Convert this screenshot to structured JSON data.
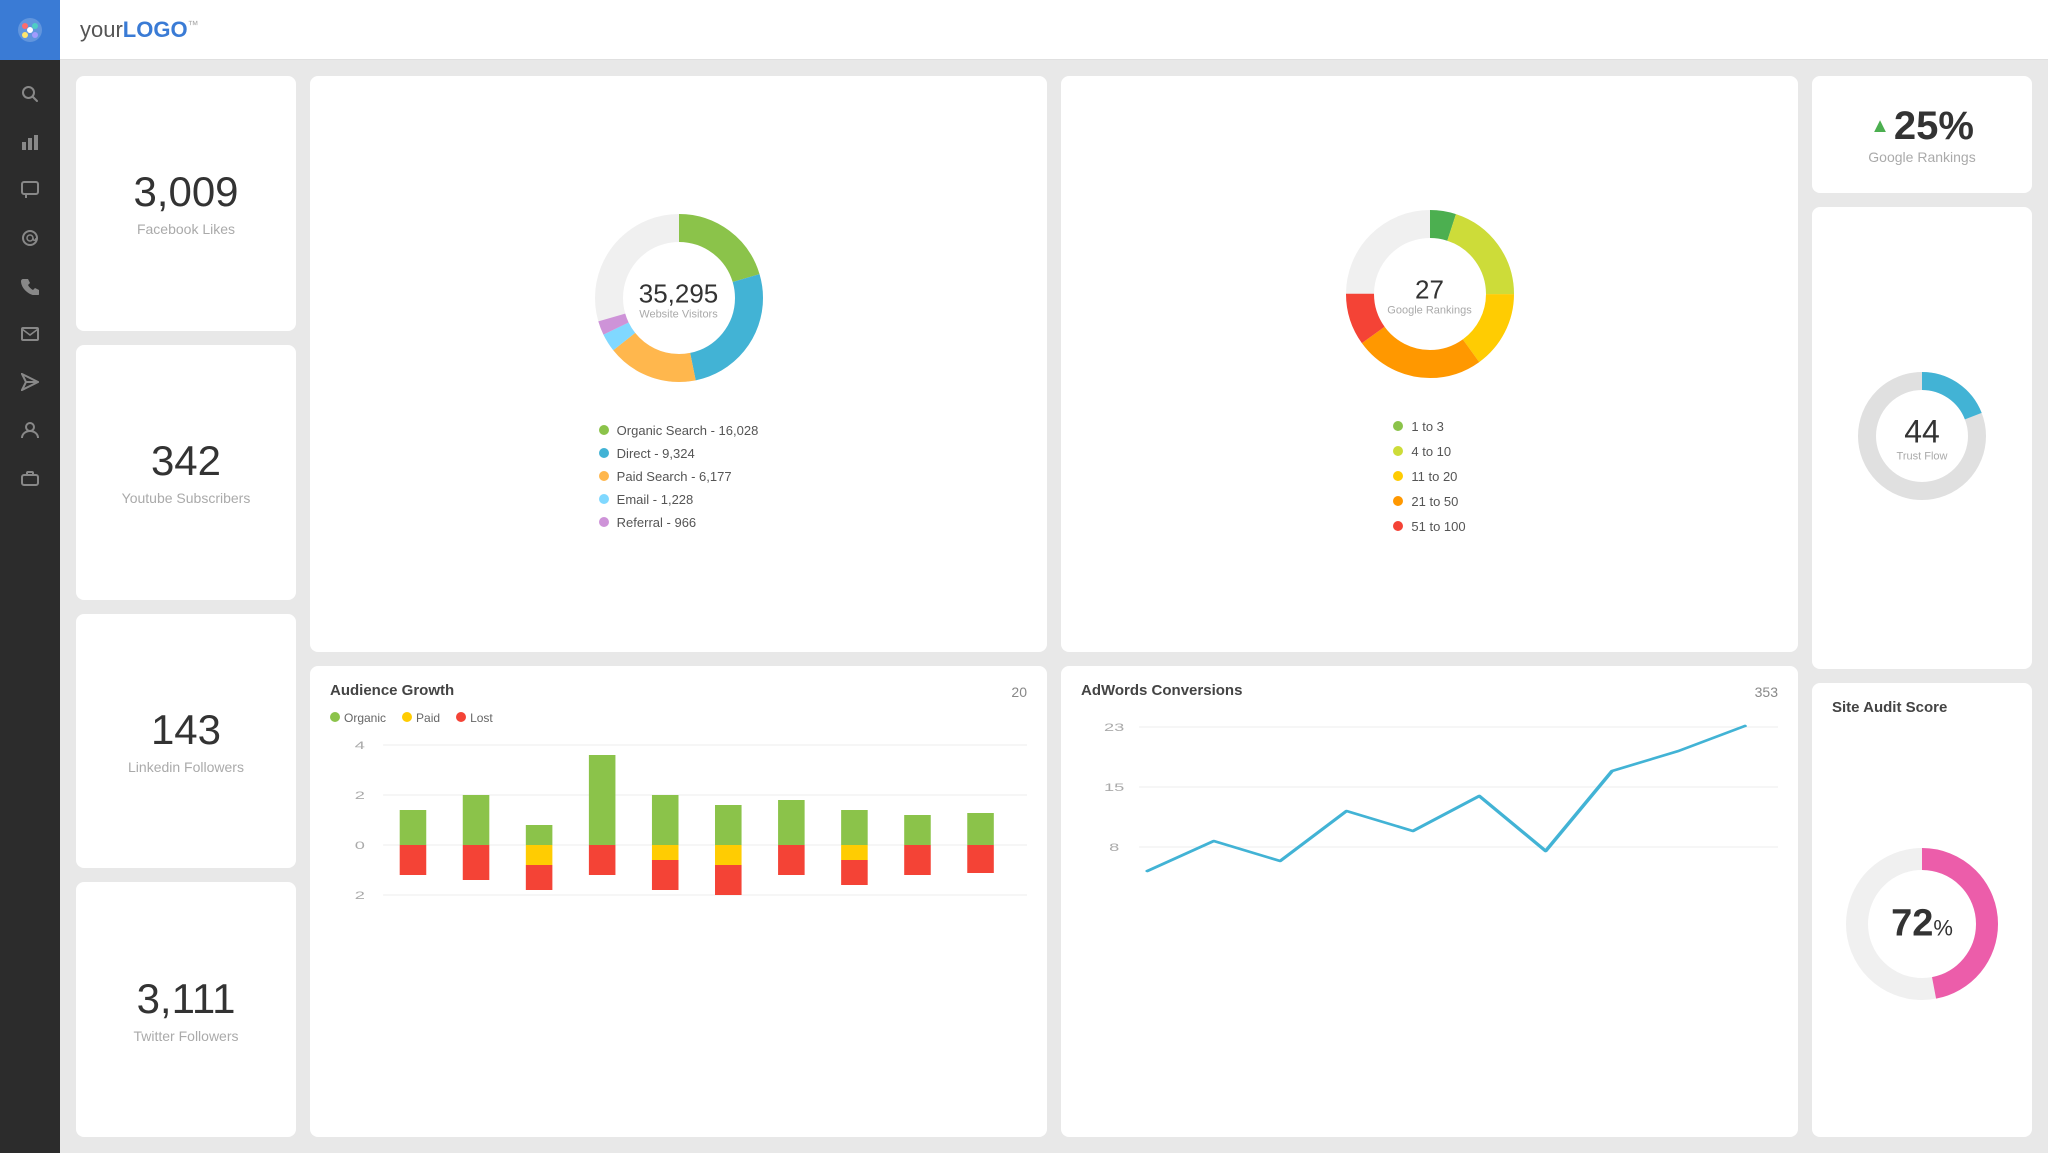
{
  "app": {
    "logo_prefix": "your",
    "logo_brand": "LOGO",
    "logo_tm": "™"
  },
  "sidebar": {
    "icons": [
      "palette",
      "search",
      "bar-chart",
      "comment",
      "at",
      "phone",
      "envelope",
      "send",
      "user",
      "briefcase"
    ]
  },
  "stats": {
    "facebook": {
      "number": "3,009",
      "label": "Facebook Likes"
    },
    "youtube": {
      "number": "342",
      "label": "Youtube Subscribers"
    },
    "linkedin": {
      "number": "143",
      "label": "Linkedin Followers"
    },
    "twitter": {
      "number": "3,111",
      "label": "Twitter Followers"
    }
  },
  "visitors": {
    "total": "35,295",
    "label": "Website Visitors",
    "legend": [
      {
        "label": "Organic Search - 16,028",
        "color": "#8bc34a"
      },
      {
        "label": "Direct - 9,324",
        "color": "#42b3d5"
      },
      {
        "label": "Paid Search - 6,177",
        "color": "#ffb74d"
      },
      {
        "label": "Email - 1,228",
        "color": "#80d8ff"
      },
      {
        "label": "Referral - 966",
        "color": "#ce93d8"
      }
    ]
  },
  "rankings": {
    "total": "27",
    "label": "Google Rankings",
    "legend": [
      {
        "label": "1 to 3",
        "color": "#8bc34a"
      },
      {
        "label": "4 to 10",
        "color": "#cddc39"
      },
      {
        "label": "11 to 20",
        "color": "#ffcc02"
      },
      {
        "label": "21 to 50",
        "color": "#ff9800"
      },
      {
        "label": "51 to 100",
        "color": "#f44336"
      }
    ]
  },
  "google_rank": {
    "percent": "25%",
    "label": "Google Rankings"
  },
  "trust_flow": {
    "number": "44",
    "label": "Trust Flow"
  },
  "audience": {
    "title": "Audience Growth",
    "count": "20",
    "legend": [
      "Organic",
      "Paid",
      "Lost"
    ],
    "colors": [
      "#8bc34a",
      "#ffcc02",
      "#f44336"
    ]
  },
  "conversions": {
    "title": "AdWords Conversions",
    "count": "353",
    "y_labels": [
      "23",
      "15",
      "8"
    ]
  },
  "audit": {
    "title": "Site Audit Score",
    "percent": "72",
    "percent_symbol": "%"
  }
}
